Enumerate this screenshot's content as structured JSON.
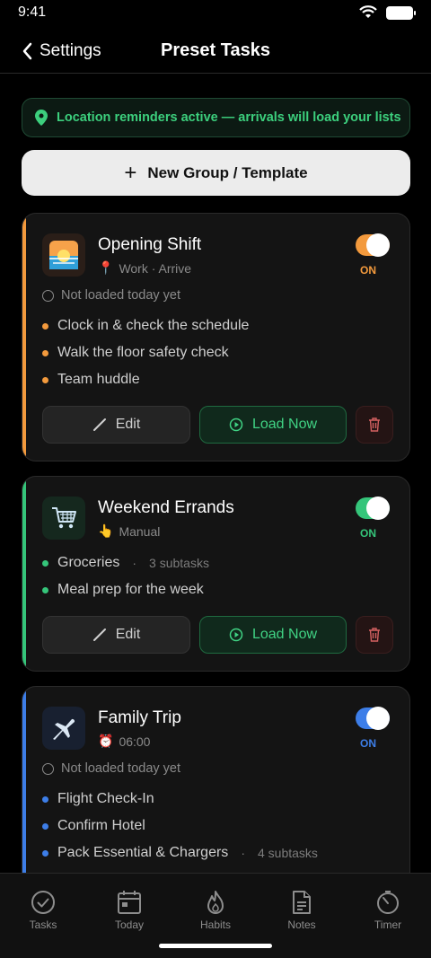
{
  "status": {
    "time": "9:41"
  },
  "nav": {
    "back_label": "Settings",
    "title": "Preset Tasks"
  },
  "banner": {
    "text": "Location reminders active — arrivals will load your lists"
  },
  "new_group": {
    "label": "New Group / Template"
  },
  "colors": {
    "orange": "#f39a3d",
    "green": "#35c57a",
    "blue": "#3d7ee8"
  },
  "cards": [
    {
      "title": "Opening Shift",
      "subtitle_icon": "pin-icon",
      "subtitle_emoji": "📍",
      "subtitle": "Work · Arrive",
      "toggle_label": "ON",
      "status": "Not loaded today yet",
      "tasks": [
        {
          "label": "Clock in & check the schedule",
          "meta": ""
        },
        {
          "label": "Walk the floor safety check",
          "meta": ""
        },
        {
          "label": "Team huddle",
          "meta": ""
        }
      ],
      "edit_label": "Edit",
      "load_label": "Load Now"
    },
    {
      "title": "Weekend Errands",
      "subtitle_emoji": "👆",
      "subtitle": "Manual",
      "toggle_label": "ON",
      "tasks": [
        {
          "label": "Groceries",
          "meta": "3 subtasks"
        },
        {
          "label": "Meal prep for the week",
          "meta": ""
        }
      ],
      "edit_label": "Edit",
      "load_label": "Load Now"
    },
    {
      "title": "Family Trip",
      "subtitle_emoji": "⏰",
      "subtitle": "06:00",
      "toggle_label": "ON",
      "status": "Not loaded today yet",
      "tasks": [
        {
          "label": "Flight Check-In",
          "meta": ""
        },
        {
          "label": "Confirm Hotel",
          "meta": ""
        },
        {
          "label": "Pack Essential & Chargers",
          "meta": "4 subtasks"
        }
      ]
    }
  ],
  "tabs": [
    {
      "label": "Tasks",
      "icon": "check-circle-icon"
    },
    {
      "label": "Today",
      "icon": "calendar-icon"
    },
    {
      "label": "Habits",
      "icon": "flame-icon"
    },
    {
      "label": "Notes",
      "icon": "note-icon"
    },
    {
      "label": "Timer",
      "icon": "timer-icon"
    }
  ]
}
